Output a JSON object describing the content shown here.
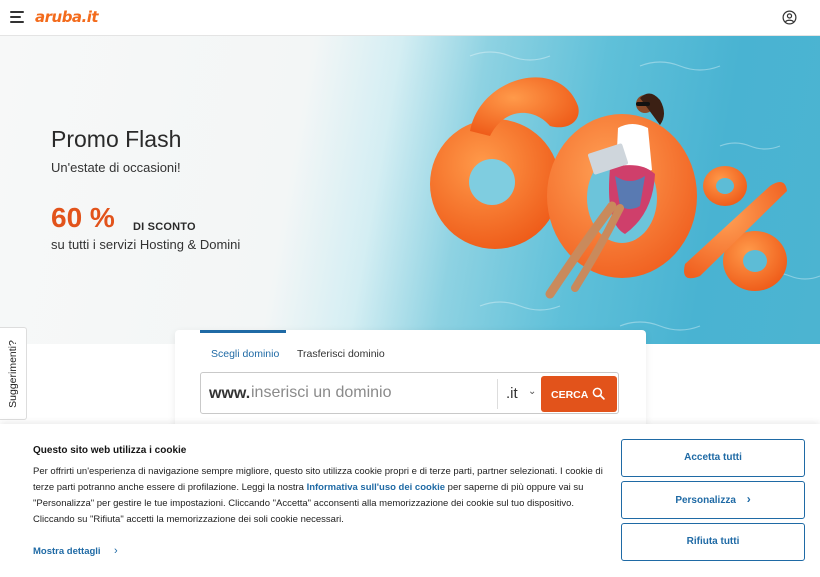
{
  "header": {
    "logo_text": "aruba.it",
    "menu_icon": "hamburger-menu-icon",
    "account_icon": "user-account-icon"
  },
  "hero": {
    "title": "Promo Flash",
    "subtitle": "Un'estate di occasioni!",
    "discount_value": "60 %",
    "discount_label": "DI SCONTO",
    "services_text": "su tutti i servizi Hosting & Domini",
    "image_text": "60%"
  },
  "search": {
    "tabs": [
      {
        "label": "Scegli dominio",
        "active": true
      },
      {
        "label": "Trasferisci dominio",
        "active": false
      }
    ],
    "prefix": "www.",
    "placeholder": "inserisci un dominio",
    "tld": ".it",
    "button_label": "CERCA"
  },
  "side_tab": {
    "label": "Suggerimenti?"
  },
  "cookie_banner": {
    "title": "Questo sito web utilizza i cookie",
    "text_before_link": "Per offrirti un'esperienza di navigazione sempre migliore, questo sito utilizza cookie propri e di terze parti, partner selezionati. I cookie di terze parti potranno anche essere di profilazione. Leggi la nostra ",
    "link_text": "Informativa sull'uso dei cookie",
    "text_after_link": " per saperne di più oppure vai su \"Personalizza\" per gestire le tue impostazioni. Cliccando \"Accetta\" acconsenti alla memorizzazione dei cookie sul tuo dispositivo. Cliccando su \"Rifiuta\" accetti la memorizzazione dei soli cookie necessari.",
    "details_label": "Mostra dettagli",
    "buttons": {
      "accept": "Accetta tutti",
      "customize": "Personalizza",
      "reject": "Rifiuta tutti"
    }
  },
  "colors": {
    "brand_orange": "#e2531b",
    "link_blue": "#1f6aa5"
  }
}
